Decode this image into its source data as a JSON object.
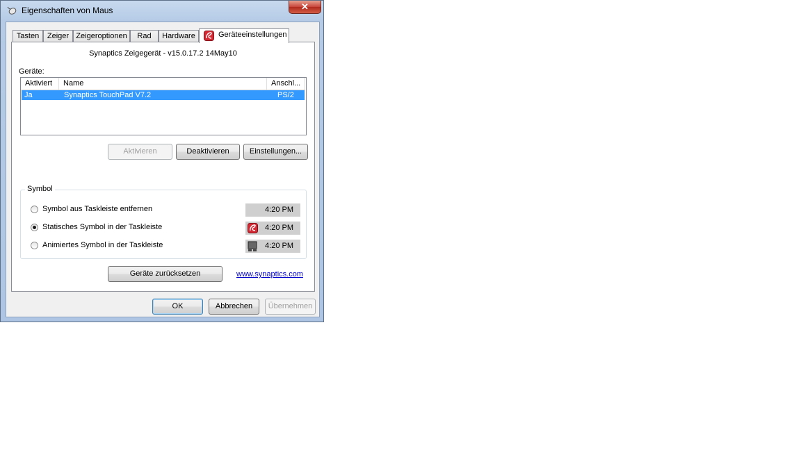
{
  "window": {
    "title": "Eigenschaften von Maus",
    "close_glyph": "✕"
  },
  "tabs": [
    {
      "label": "Tasten"
    },
    {
      "label": "Zeiger"
    },
    {
      "label": "Zeigeroptionen"
    },
    {
      "label": "Rad"
    },
    {
      "label": "Hardware"
    },
    {
      "label": "Geräteeinstellungen",
      "active": true
    }
  ],
  "panel": {
    "driver_info": "Synaptics Zeigegerät - v15.0.17.2 14May10",
    "devices_label": "Geräte:",
    "columns": [
      "Aktiviert",
      "Name",
      "Anschl..."
    ],
    "rows": [
      {
        "enabled": "Ja",
        "name": "Synaptics TouchPad V7.2",
        "port": "PS/2"
      }
    ],
    "buttons": {
      "activate": "Aktivieren",
      "deactivate": "Deaktivieren",
      "settings": "Einstellungen..."
    },
    "symbol_group": {
      "label": "Symbol",
      "options": [
        {
          "label": "Symbol aus Taskleiste entfernen",
          "selected": false,
          "time": "4:20 PM",
          "icon": "none"
        },
        {
          "label": "Statisches Symbol in der Taskleiste",
          "selected": true,
          "time": "4:20 PM",
          "icon": "synaptics-icon"
        },
        {
          "label": "Animiertes Symbol in der Taskleiste",
          "selected": false,
          "time": "4:20 PM",
          "icon": "touchpad-icon"
        }
      ]
    },
    "reset_button": "Geräte zurücksetzen",
    "website_link": "www.synaptics.com"
  },
  "dialog_buttons": {
    "ok": "OK",
    "cancel": "Abbrechen",
    "apply": "Übernehmen"
  },
  "colors": {
    "selection": "#3399ff",
    "synaptics_red": "#d42a35",
    "link": "#0000cc"
  }
}
